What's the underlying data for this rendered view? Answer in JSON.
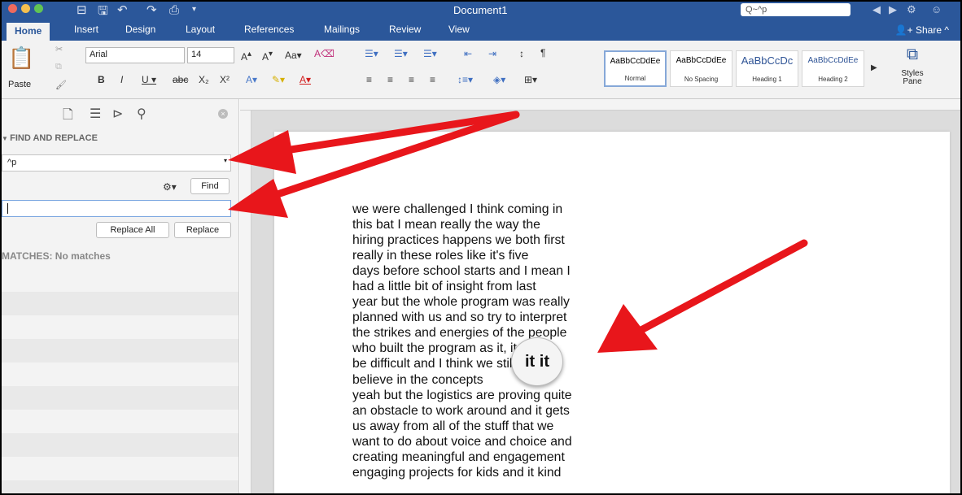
{
  "window": {
    "title": "Document1"
  },
  "title_search": {
    "value": "Q~^p"
  },
  "tabs": [
    "Home",
    "Insert",
    "Design",
    "Layout",
    "References",
    "Mailings",
    "Review",
    "View"
  ],
  "share_label": "Share",
  "ribbon": {
    "paste_label": "Paste",
    "font_name": "Arial",
    "font_size": "14",
    "styles": [
      {
        "preview": "AaBbCcDdEe",
        "label": "Normal"
      },
      {
        "preview": "AaBbCcDdEe",
        "label": "No Spacing"
      },
      {
        "preview": "AaBbCcDc",
        "label": "Heading 1"
      },
      {
        "preview": "AaBbCcDdEe",
        "label": "Heading 2"
      }
    ],
    "styles_pane_label": "Styles Pane"
  },
  "sidebar": {
    "heading": "FIND AND REPLACE",
    "find_value": "^p",
    "find_button": "Find",
    "replace_value": "",
    "replace_all_button": "Replace All",
    "replace_button": "Replace",
    "matches_text": "MATCHES: No matches"
  },
  "document": {
    "lines": [
      "we were challenged I think coming in",
      "this bat I mean really the way the",
      "hiring practices happens we both first",
      "really in these roles like it's five",
      "days before school starts and I mean I",
      "had a little bit of insight from last",
      "year but the whole program was really",
      "planned with us and so try to interpret",
      "the strikes and energies of the people",
      "who built the program as it, it can",
      "be difficult and I think we still",
      "believe in the concepts",
      "yeah but the logistics are proving quite",
      "an obstacle to work around and it gets",
      "us away from all of the stuff that we",
      "want to do about voice and choice and",
      "creating meaningful and engagement",
      "engaging projects for kids and it kind"
    ],
    "magnifier_text": "it it"
  },
  "colors": {
    "word_blue": "#2b579a",
    "arrow_red": "#e8161b"
  },
  "icons": {
    "sidebar": [
      "document-icon",
      "list-icon",
      "navigation-icon",
      "search-icon"
    ]
  }
}
